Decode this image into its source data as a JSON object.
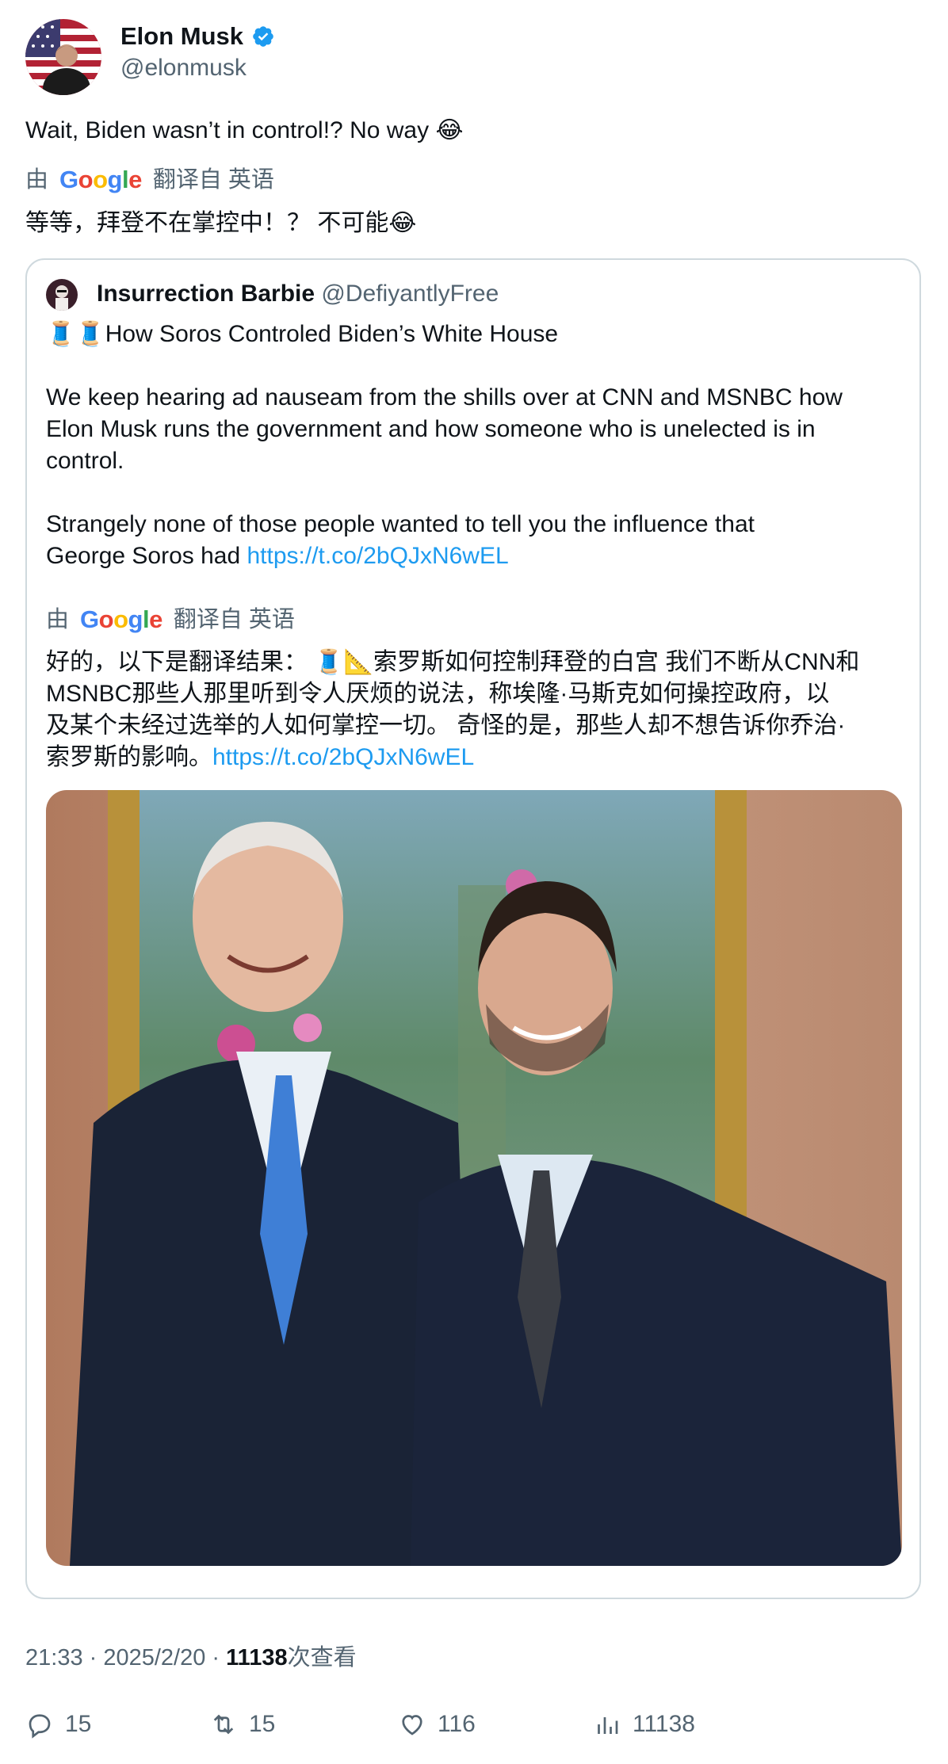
{
  "author": {
    "name": "Elon Musk",
    "handle": "@elonmusk",
    "verified": true
  },
  "tweet": {
    "text": "Wait, Biden wasn’t in control!? No way 😂",
    "translation_by": "由",
    "google": {
      "G": "G",
      "o1": "o",
      "o2": "o",
      "g": "g",
      "l": "l",
      "e": "e"
    },
    "translated_from": "翻译自 英语",
    "translated_text": "等等，拜登不在掌控中！？ 不可能😂"
  },
  "quote": {
    "name": "Insurrection Barbie",
    "handle": "@DefiyantlyFree",
    "line1": "🧵🧵How Soros Controled Biden’s White House",
    "para1_l1": "We keep hearing ad nauseam from the shills over at CNN and MSNBC how",
    "para1_l2": "Elon Musk runs the government and how someone who is unelected is in",
    "para1_l3": "control.",
    "para2_l1": "Strangely none of those people wanted to tell you the influence that",
    "para2_l2": "George Soros had ",
    "link": "https://t.co/2bQJxN6wEL",
    "translation_by": "由",
    "translated_from": "翻译自 英语",
    "tr_l1": "好的，以下是翻译结果：  🧵📐索罗斯如何控制拜登的白宫 我们不断从CNN和",
    "tr_l2": "MSNBC那些人那里听到令人厌烦的说法，称埃隆·马斯克如何操控政府，以",
    "tr_l3": "及某个未经过选举的人如何掌控一切。 奇怪的是，那些人却不想告诉你乔治·",
    "tr_l4": "索罗斯的影响。",
    "tr_link": "https://t.co/2bQJxN6wEL"
  },
  "meta": {
    "time": "21:33 · 2025/2/20 · ",
    "views": "11138",
    "views_suffix": "次查看"
  },
  "actions": {
    "replies": "15",
    "reposts": "15",
    "likes": "116",
    "views": "11138"
  },
  "colors": {
    "text": "#0f1419",
    "secondary": "#536471",
    "link": "#1d9bf0",
    "border": "#cfd9de",
    "verified": "#1d9bf0"
  }
}
